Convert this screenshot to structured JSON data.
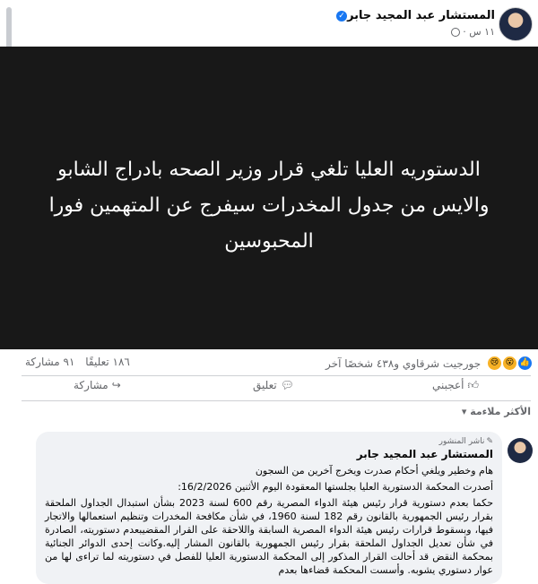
{
  "post": {
    "author": "المستشار عبد المجيد جابر",
    "time": "١١ س",
    "headline": "الدستوريه العليا تلغي قرار وزير الصحه بادراج الشابو والايس من جدول المخدرات سيفرج عن المتهمين فورا المحبوسين"
  },
  "stats": {
    "reactions_text": "جورجيت شرقاوي و٤٣٨ شخصًا آخر",
    "comments": "١٨٦ تعليقًا",
    "shares": "٩١ مشاركة"
  },
  "actions": {
    "like": "أعجبني",
    "comment": "تعليق",
    "share": "مشاركة"
  },
  "comments_sort": "الأكثر ملاءمة",
  "comment": {
    "badge": "ناشر المنشور",
    "author": "المستشار عبد المجيد جابر",
    "line1": "هام وخطير ويلغي أحكام صدرت ويخرج آخرين من السجون",
    "line2": "أصدرت المحكمة الدستورية العليا بجلستها المعقودة اليوم الأثنين 16/2/2026:",
    "paragraph": "حكما بعدم دستورية قرار رئيس هيئة الدواء المصرية رقم 600 لسنة 2023 بشأن استبدال الجداول الملحقة بقرار رئيس الجمهورية بالقانون رقم 182 لسنة 1960، في شأن مكافحة المخدرات وتنظيم استعمالها والاتجار فيها، وبسقوط قرارات رئيس هيئة الدواء المصرية السابقة واللاحقة على القرار المقضيبعدم دستوريته، الصادرة في شأن تعديل الجداول الملحقة بقرار رئيس الجمهورية بالقانون المشار إليه.وكانت إحدى الدوائر الجنائية بمحكمة النقض قد أحالت القرار المذكور إلى المحكمة الدستورية العليا للفصل في دستوريته لما تراءى لها من عوار دستوري يشوبه. وأسست المحكمة قضاءها بعدم"
  },
  "colors": {
    "accent": "#1877f2",
    "image_bg": "#181818",
    "secondary_text": "#65676b",
    "bubble_bg": "#f0f2f5"
  }
}
